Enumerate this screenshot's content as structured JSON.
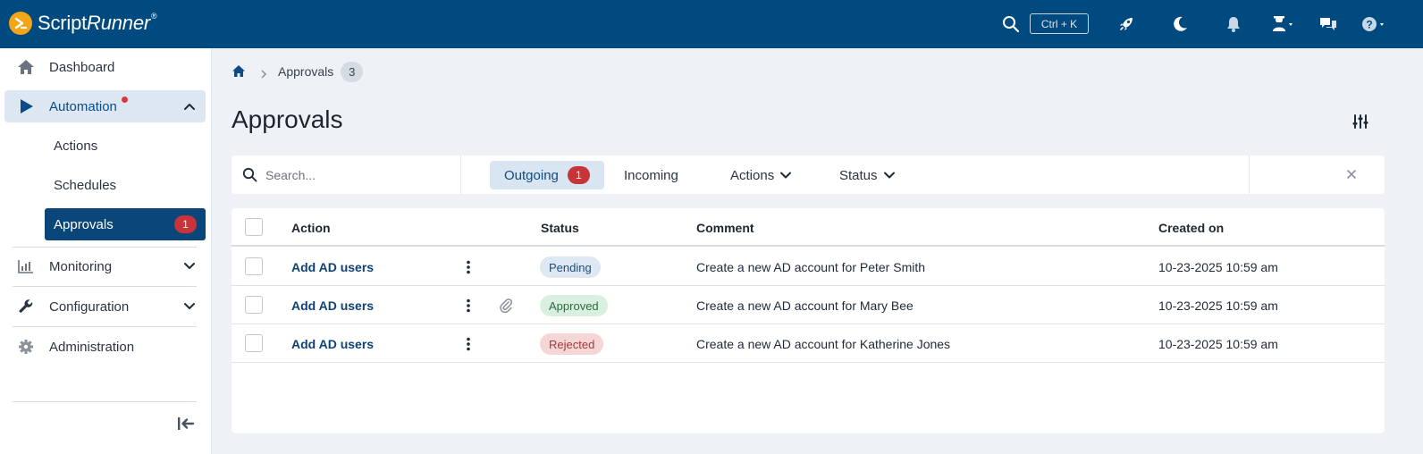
{
  "app": {
    "brand_main": "Script",
    "brand_italic": "Runner",
    "brand_reg": "®",
    "search_shortcut": "Ctrl + K",
    "header_color": "#004a7f"
  },
  "sidebar": {
    "dashboard": "Dashboard",
    "automation": "Automation",
    "actions": "Actions",
    "schedules": "Schedules",
    "approvals": "Approvals",
    "approvals_badge": "1",
    "monitoring": "Monitoring",
    "configuration": "Configuration",
    "administration": "Administration"
  },
  "breadcrumb": {
    "current": "Approvals",
    "count": "3"
  },
  "page": {
    "title": "Approvals"
  },
  "filters": {
    "search_placeholder": "Search...",
    "tab_outgoing": "Outgoing",
    "tab_outgoing_badge": "1",
    "tab_incoming": "Incoming",
    "dropdown_actions": "Actions",
    "dropdown_status": "Status"
  },
  "table": {
    "headers": {
      "action": "Action",
      "status": "Status",
      "comment": "Comment",
      "created_on": "Created on"
    },
    "rows": [
      {
        "action": "Add AD users",
        "status": "Pending",
        "comment": "Create a new AD account for Peter Smith",
        "created_on": "10-23-2025 10:59 am"
      },
      {
        "action": "Add AD users",
        "status": "Approved",
        "comment": "Create a new AD account for Mary Bee",
        "created_on": "10-23-2025 10:59 am"
      },
      {
        "action": "Add AD users",
        "status": "Rejected",
        "comment": "Create a new AD account for Katherine Jones",
        "created_on": "10-23-2025 10:59 am"
      }
    ]
  }
}
